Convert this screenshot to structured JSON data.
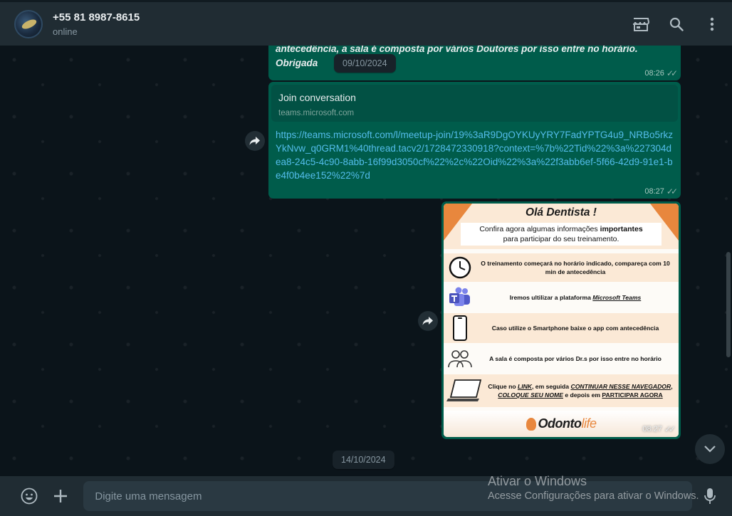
{
  "header": {
    "contact_name": "+55 81 8987-8615",
    "status": "online",
    "icons": [
      "store-icon",
      "search-icon",
      "more-vertical-icon"
    ]
  },
  "messages": {
    "m1": {
      "line1": "antecedência, a sala é composta por vários Doutores por isso entre no horário.",
      "line2": "Obrigada",
      "time": "08:26"
    },
    "date1": "09/10/2024",
    "m2": {
      "preview_title": "Join conversation",
      "preview_domain": "teams.microsoft.com",
      "link": "https://teams.microsoft.com/l/meetup-join/19%3aR9DgOYKUyYRY7FadYPTG4u9_NRBo5rkzYkNvw_q0GRM1%40thread.tacv2/1728472330918?context=%7b%22Tid%22%3a%227304dea8-24c5-4c90-8abb-16f99d3050cf%22%2c%22Oid%22%3a%22f3abb6ef-5f66-42d9-91e1-be4f0b4ee152%22%7d",
      "time": "08:27"
    },
    "m3": {
      "title": "Olá Dentista !",
      "subtitle_a": "Confira agora algumas informações ",
      "subtitle_b": "importantes",
      "subtitle_c": "para participar do seu treinamento.",
      "row1": "O treinamento começará no horário indicado, compareça com 10 min de antecedência",
      "row2_a": "Iremos ultilizar a plataforma ",
      "row2_b": "Microsoft Teams",
      "row3": "Caso utilize o Smartphone baixe o app com antecedência",
      "row4": "A sala é composta por vários Dr.s por isso entre no horário",
      "row5_a": "Clique no ",
      "row5_b": "LINK",
      "row5_c": ", em seguida ",
      "row5_d": "CONTINUAR NESSE NAVEGADOR",
      "row5_e": ", ",
      "row5_f": "COLOQUE SEU NOME",
      "row5_g": " e depois em ",
      "row5_h": "PARTICIPAR AGORA",
      "logo_a": "Odonto",
      "logo_b": "life",
      "time": "08:27"
    },
    "date2": "14/10/2024"
  },
  "footer": {
    "placeholder": "Digite uma mensagem"
  },
  "watermark": {
    "line1": "Ativar o Windows",
    "line2": "Acesse Configurações para ativar o Windows."
  },
  "colors": {
    "outgoing_bubble": "#005c4b",
    "link": "#53bdeb",
    "accent_orange": "#e8873d"
  }
}
